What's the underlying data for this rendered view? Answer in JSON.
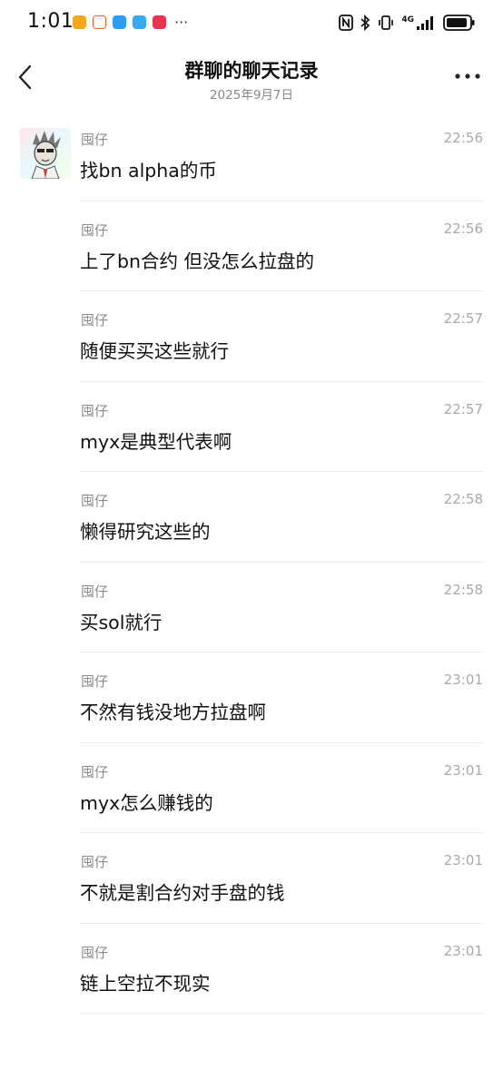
{
  "status_bar": {
    "time": "1:01",
    "notifications": [
      "app-notification-icon",
      "taobao-icon",
      "message-icon",
      "chat-bubble-icon",
      "app-red-icon"
    ],
    "more": "···",
    "network": "4G"
  },
  "header": {
    "title": "群聊的聊天记录",
    "date": "2025年9月7日"
  },
  "messages": [
    {
      "sender": "囤仔",
      "time": "22:56",
      "text": "找bn alpha的币",
      "has_avatar": true
    },
    {
      "sender": "囤仔",
      "time": "22:56",
      "text": "上了bn合约 但没怎么拉盘的"
    },
    {
      "sender": "囤仔",
      "time": "22:57",
      "text": "随便买买这些就行"
    },
    {
      "sender": "囤仔",
      "time": "22:57",
      "text": "myx是典型代表啊"
    },
    {
      "sender": "囤仔",
      "time": "22:58",
      "text": "懒得研究这些的"
    },
    {
      "sender": "囤仔",
      "time": "22:58",
      "text": "买sol就行"
    },
    {
      "sender": "囤仔",
      "time": "23:01",
      "text": "不然有钱没地方拉盘啊"
    },
    {
      "sender": "囤仔",
      "time": "23:01",
      "text": "myx怎么赚钱的"
    },
    {
      "sender": "囤仔",
      "time": "23:01",
      "text": "不就是割合约对手盘的钱"
    },
    {
      "sender": "囤仔",
      "time": "23:01",
      "text": "链上空拉不现实"
    }
  ]
}
